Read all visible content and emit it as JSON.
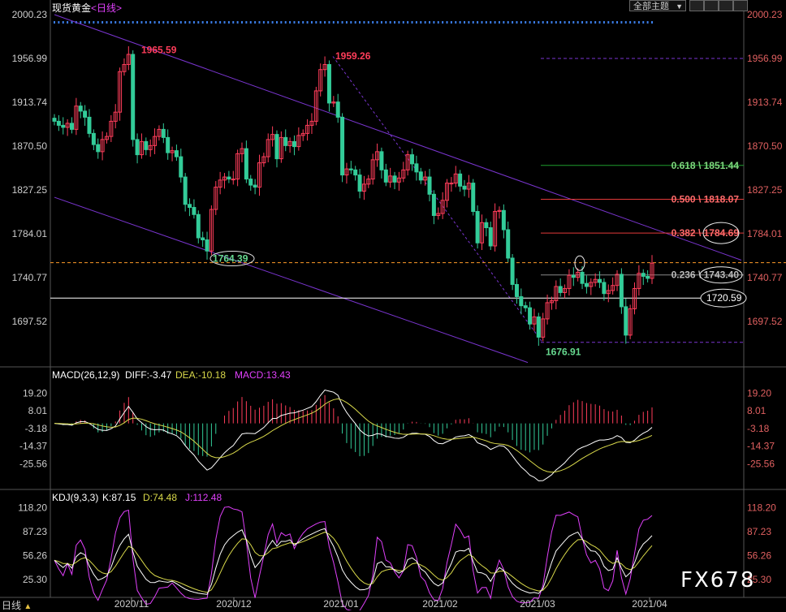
{
  "header": {
    "instrument": "现货黄金",
    "period": "<日线>",
    "theme_button": "全部主题"
  },
  "period_tag": "日线",
  "watermark": "FX678",
  "colors": {
    "up": "#ff3d5a",
    "down": "#33cc99",
    "channel": "#7a35d0",
    "fib_green": "#1e9e2e",
    "fib_red": "#e23a3a",
    "last_price": "#ff9b28",
    "macd_dif": "#ffffff",
    "macd_dea": "#d9d94a",
    "kdj_k": "#ffffff",
    "kdj_d": "#d9d94a",
    "kdj_j": "#e040fb"
  },
  "chart_data": [
    {
      "type": "candlestick",
      "title": "现货黄金<日线>",
      "y_ticks": [
        "2000.23",
        "1956.99",
        "1913.74",
        "1870.50",
        "1827.25",
        "1784.01",
        "1740.77",
        "1697.52"
      ],
      "ylim": [
        1655,
        2000.23
      ],
      "x_ticks": [
        "2020/11",
        "2020/12",
        "2021/01",
        "2021/02",
        "2021/03",
        "2021/04"
      ],
      "annotations": {
        "high1": "1965.59",
        "low1": "1764.39",
        "high2": "1959.26",
        "low2": "1676.91",
        "support": "1720.59"
      },
      "fibonacci": [
        {
          "label": "0.618 \\ 1851.44",
          "value": 1851.44,
          "color": "green"
        },
        {
          "label": "0.500 \\ 1818.07",
          "value": 1818.07,
          "color": "red"
        },
        {
          "label": "0.382 \\ 1784.69",
          "value": 1784.69,
          "color": "red"
        },
        {
          "label": "0.236 \\ 1743.40",
          "value": 1743.4,
          "color": "gray"
        }
      ],
      "last_price": 1755.5,
      "closes": [
        1895,
        1891,
        1889,
        1893,
        1887,
        1910,
        1905,
        1899,
        1883,
        1872,
        1865,
        1877,
        1880,
        1895,
        1904,
        1944,
        1951,
        1961,
        1877,
        1862,
        1875,
        1867,
        1871,
        1880,
        1887,
        1879,
        1864,
        1866,
        1860,
        1840,
        1813,
        1810,
        1803,
        1780,
        1778,
        1767,
        1808,
        1830,
        1837,
        1840,
        1838,
        1838,
        1863,
        1868,
        1838,
        1832,
        1830,
        1854,
        1860,
        1877,
        1882,
        1858,
        1879,
        1871,
        1875,
        1870,
        1881,
        1883,
        1891,
        1895,
        1925,
        1946,
        1951,
        1913,
        1914,
        1899,
        1842,
        1848,
        1847,
        1842,
        1826,
        1833,
        1838,
        1857,
        1865,
        1847,
        1835,
        1841,
        1835,
        1839,
        1847,
        1862,
        1853,
        1845,
        1837,
        1840,
        1823,
        1802,
        1804,
        1817,
        1834,
        1834,
        1843,
        1831,
        1828,
        1834,
        1806,
        1775,
        1795,
        1790,
        1772,
        1806,
        1807,
        1788,
        1760,
        1734,
        1722,
        1713,
        1711,
        1695,
        1702,
        1682,
        1700,
        1716,
        1718,
        1732,
        1726,
        1730,
        1743,
        1741,
        1746,
        1735,
        1732,
        1736,
        1739,
        1736,
        1725,
        1728,
        1733,
        1744,
        1712,
        1684,
        1710,
        1730,
        1745,
        1742,
        1740,
        1755
      ]
    },
    {
      "type": "bar",
      "title": "MACD(26,12,9)",
      "legend": {
        "dif": "DIFF:-3.47",
        "dea": "DEA:-10.18",
        "macd": "MACD:13.43"
      },
      "y_ticks": [
        "19.20",
        "8.01",
        "-3.18",
        "-14.37",
        "-25.56"
      ],
      "ylim": [
        -36.7,
        25
      ]
    },
    {
      "type": "line",
      "title": "KDJ(9,3,3)",
      "legend": {
        "k": "K:87.15",
        "d": "D:74.48",
        "j": "J:112.48"
      },
      "y_ticks": [
        "118.20",
        "87.23",
        "56.26",
        "25.30"
      ],
      "ylim": [
        2,
        128
      ]
    }
  ]
}
